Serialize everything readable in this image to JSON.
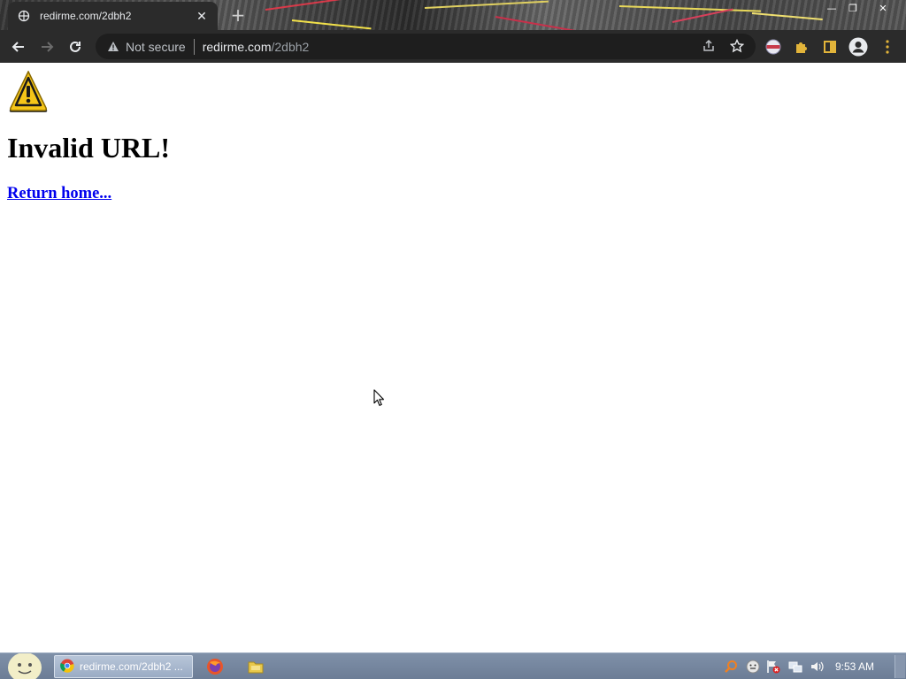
{
  "browser": {
    "tab": {
      "title": "redirme.com/2dbh2",
      "close": "✕"
    },
    "new_tab": "+",
    "window_controls": {
      "minimize": "—",
      "maximize": "❐",
      "close": "✕"
    },
    "omnibox": {
      "security_label": "Not secure",
      "url_host": "redirme.com",
      "url_path": "/2dbh2"
    },
    "icons": [
      "back-arrow-icon",
      "forward-arrow-icon",
      "reload-icon",
      "warning-triangle-icon",
      "share-icon",
      "star-bookmark-icon",
      "profile-flag-icon",
      "extensions-puzzle-icon",
      "side-panel-icon",
      "account-avatar-icon",
      "kebab-menu-icon"
    ]
  },
  "page": {
    "heading": "Invalid URL!",
    "link": "Return home..."
  },
  "taskbar": {
    "active_task_label": "redirme.com/2dbh2 ...",
    "clock": "9:53 AM"
  },
  "colors": {
    "toolbar_bg": "#2b2b2b",
    "omnibox_bg": "#1e1e1e",
    "link": "#0000ee",
    "taskbar": "#7388a3",
    "warning_yellow": "#f5c518"
  }
}
